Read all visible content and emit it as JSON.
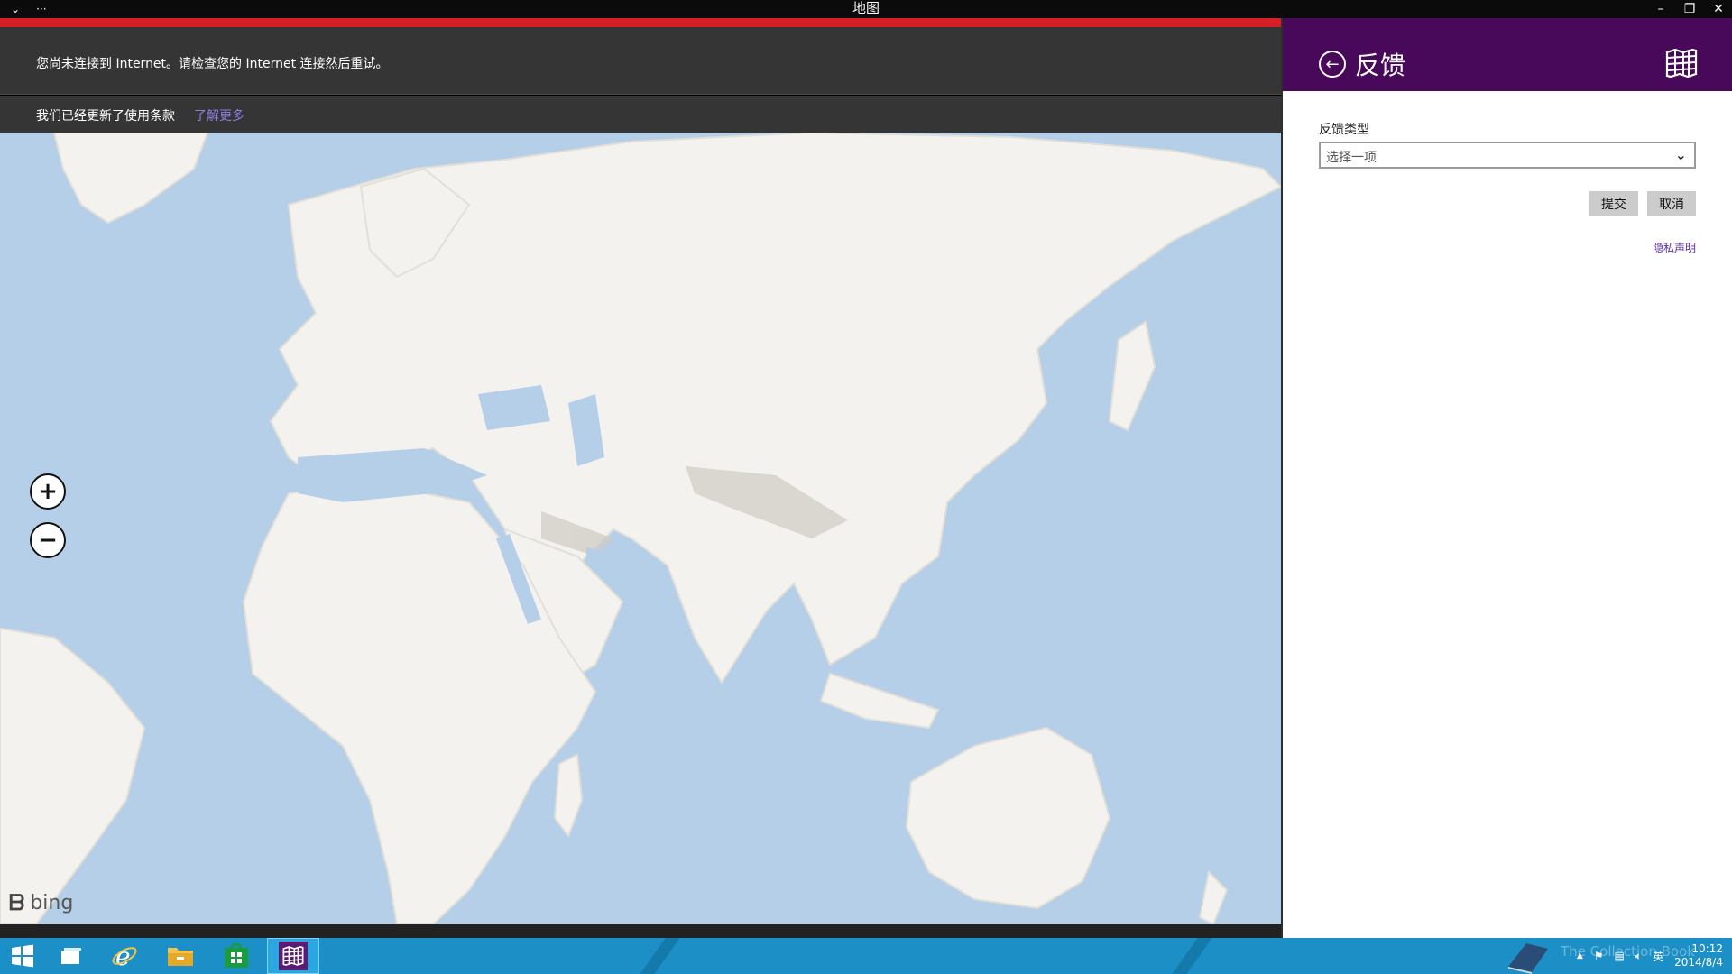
{
  "window": {
    "title": "地图",
    "menu_glyph": "⌄",
    "more_glyph": "···",
    "minimize": "–",
    "restore": "❐",
    "close": "✕"
  },
  "map_app": {
    "notice_text": "您尚未连接到 Internet。请检查您的 Internet 连接然后重试。",
    "terms_text": "我们已经更新了使用条款",
    "learn_more": "了解更多",
    "zoom_in_label": "+",
    "zoom_out_label": "−",
    "bing_label": "bing",
    "bing_icon": "b-logo-icon",
    "accent_color": "#d61f26",
    "water_color": "#b6cfe9",
    "land_color": "#f4f2ee"
  },
  "feedback_pane": {
    "title": "反馈",
    "back_icon": "back-arrow-icon",
    "logo_icon": "maps-app-icon",
    "header_color": "#48095a",
    "type_label": "反馈类型",
    "select_placeholder": "选择一项",
    "submit_label": "提交",
    "cancel_label": "取消",
    "privacy_label": "隐私声明"
  },
  "taskbar": {
    "items": [
      {
        "name": "start-button",
        "icon": "windows-logo-icon"
      },
      {
        "name": "task-view-button",
        "icon": "window-icon"
      },
      {
        "name": "internet-explorer-button",
        "icon": "ie-icon"
      },
      {
        "name": "file-explorer-button",
        "icon": "folder-icon"
      },
      {
        "name": "store-button",
        "icon": "store-icon"
      },
      {
        "name": "maps-button",
        "icon": "maps-app-icon"
      }
    ],
    "watermark": "The Collection Book",
    "tray_arrow": "▲",
    "ime": "英",
    "time": "10:12",
    "date": "2014/8/4"
  }
}
